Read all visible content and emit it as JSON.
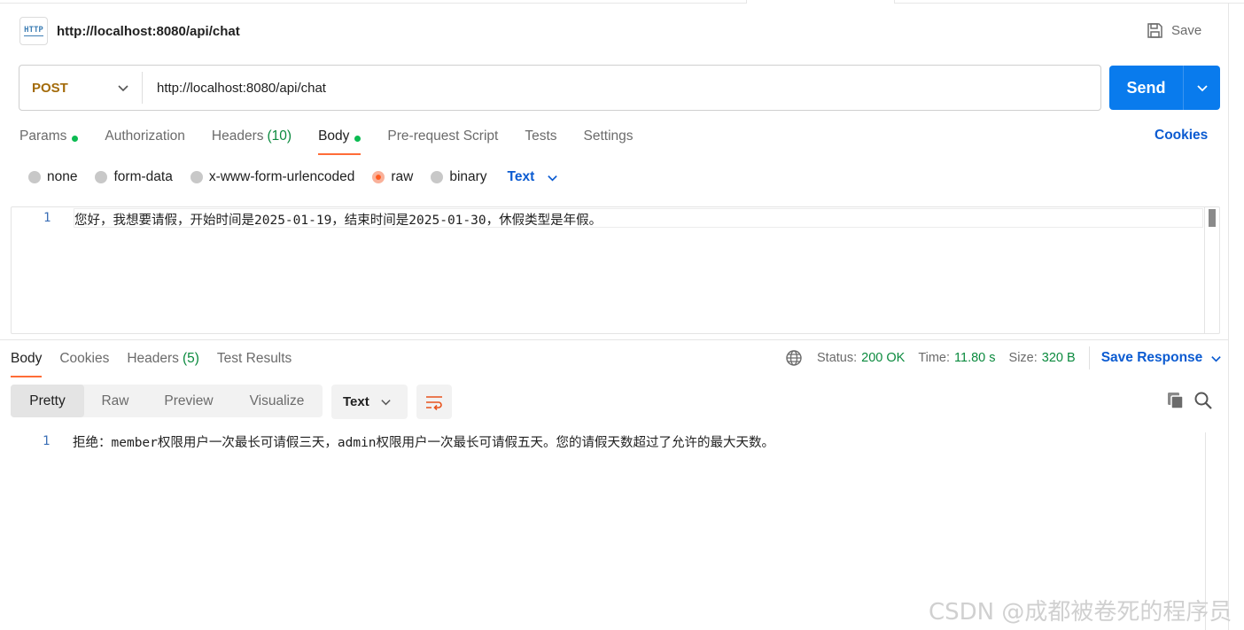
{
  "request": {
    "title": "http://localhost:8080/api/chat",
    "save_label": "Save",
    "method": "POST",
    "url": "http://localhost:8080/api/chat",
    "send_label": "Send"
  },
  "request_tabs": [
    {
      "label": "Params",
      "dot": true
    },
    {
      "label": "Authorization"
    },
    {
      "label": "Headers",
      "count": "(10)"
    },
    {
      "label": "Body",
      "dot": true,
      "active": true
    },
    {
      "label": "Pre-request Script"
    },
    {
      "label": "Tests"
    },
    {
      "label": "Settings"
    }
  ],
  "cookies_label": "Cookies",
  "body_types": [
    "none",
    "form-data",
    "x-www-form-urlencoded",
    "raw",
    "binary"
  ],
  "body_type_selected": "raw",
  "body_format": "Text",
  "request_body": {
    "line_no": "1",
    "text": "您好，我想要请假，开始时间是2025-01-19，结束时间是2025-01-30，休假类型是年假。"
  },
  "response_tabs": [
    {
      "label": "Body",
      "active": true
    },
    {
      "label": "Cookies"
    },
    {
      "label": "Headers",
      "count": "(5)"
    },
    {
      "label": "Test Results"
    }
  ],
  "response_meta": {
    "status_label": "Status:",
    "status_value": "200 OK",
    "time_label": "Time:",
    "time_value": "11.80 s",
    "size_label": "Size:",
    "size_value": "320 B",
    "save_response": "Save Response"
  },
  "view_modes": [
    "Pretty",
    "Raw",
    "Preview",
    "Visualize"
  ],
  "view_mode_active": "Pretty",
  "response_format": "Text",
  "response_body": {
    "line_no": "1",
    "text": "拒绝：member权限用户一次最长可请假三天，admin权限用户一次最长可请假五天。您的请假天数超过了允许的最大天数。"
  },
  "watermark": "CSDN @成都被卷死的程序员",
  "colors": {
    "accent": "#ff6c37",
    "send": "#097bed",
    "link": "#0b5bd1",
    "success": "#0b8a3e",
    "method": "#a36b0a"
  }
}
